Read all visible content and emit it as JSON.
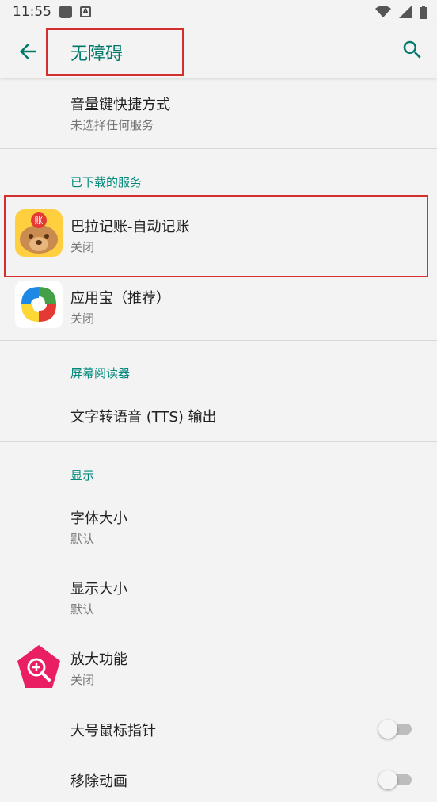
{
  "status": {
    "time": "11:55"
  },
  "header": {
    "title": "无障碍"
  },
  "shortcut": {
    "title": "音量键快捷方式",
    "subtitle": "未选择任何服务"
  },
  "downloaded": {
    "header": "已下载的服务",
    "items": [
      {
        "title": "巴拉记账-自动记账",
        "subtitle": "关闭",
        "badge": "账"
      },
      {
        "title": "应用宝（推荐）",
        "subtitle": "关闭"
      }
    ]
  },
  "screen_reader": {
    "header": "屏幕阅读器",
    "tts": "文字转语音 (TTS) 输出"
  },
  "display": {
    "header": "显示",
    "font_size": {
      "title": "字体大小",
      "subtitle": "默认"
    },
    "display_size": {
      "title": "显示大小",
      "subtitle": "默认"
    },
    "magnification": {
      "title": "放大功能",
      "subtitle": "关闭"
    },
    "large_pointer": {
      "title": "大号鼠标指针"
    },
    "remove_animation": {
      "title": "移除动画"
    }
  },
  "colors": {
    "accent": "#00897b",
    "title": "#00796b",
    "highlight": "#d32f2f"
  }
}
